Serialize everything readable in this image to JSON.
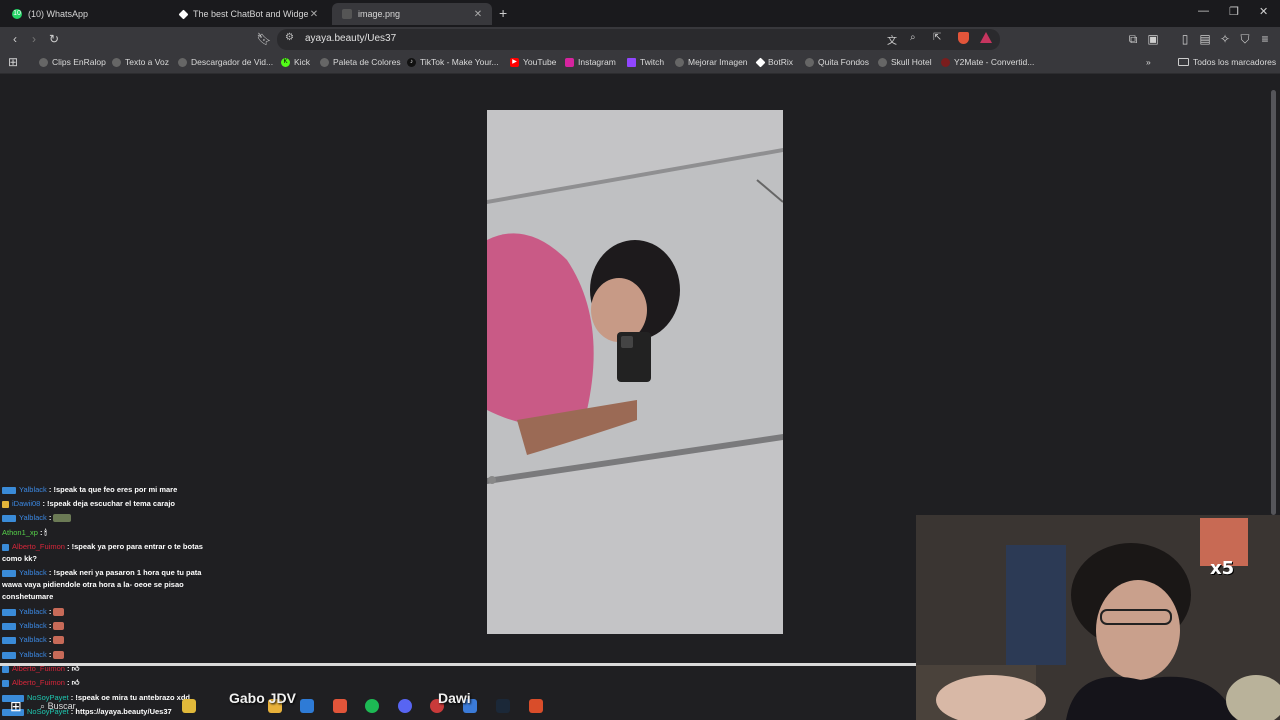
{
  "tabs": [
    {
      "title": "(10) WhatsApp"
    },
    {
      "title": "The best ChatBot and Widget"
    },
    {
      "title": "image.png"
    }
  ],
  "address": {
    "url": "ayaya.beauty/Ues37"
  },
  "bookmarks": {
    "items": [
      "Clips EnRalop",
      "Texto a Voz",
      "Descargador de Vid...",
      "Kick",
      "Paleta de Colores",
      "TikTok - Make Your...",
      "YouTube",
      "Instagram",
      "Twitch",
      "Mejorar Imagen",
      "BotRix",
      "Quita Fondos",
      "Skull Hotel",
      "Y2Mate - Convertid..."
    ],
    "all_label": "Todos los marcadores"
  },
  "chat": [
    {
      "user": "Yalblack",
      "user_color": "#3b87e0",
      "text": "!speak ta que feo eres por mi mare"
    },
    {
      "user": "iDawii08",
      "user_color": "#3b87e0",
      "text": "!speak deja escuchar el tema carajo"
    },
    {
      "user": "Yalblack",
      "user_color": "#3b87e0",
      "text": ""
    },
    {
      "user": "Athon1_xp",
      "user_color": "#56d24a",
      "text": ""
    },
    {
      "user": "Alberto_Fuimon",
      "user_color": "#d8263a",
      "text": "!speak ya pero para entrar o te botas"
    },
    {
      "user": "",
      "user_color": "#ffffff",
      "text": "como kk?"
    },
    {
      "user": "Yalblack",
      "user_color": "#3b87e0",
      "text": "!speak neri ya pasaron 1 hora que tu pata"
    },
    {
      "user": "",
      "user_color": "#ffffff",
      "text": "wawa vaya pidiendole otra hora a la- oeoe se pisao"
    },
    {
      "user": "",
      "user_color": "#ffffff",
      "text": "conshetumare"
    },
    {
      "user": "Yalblack",
      "user_color": "#3b87e0",
      "text": ""
    },
    {
      "user": "Yalblack",
      "user_color": "#3b87e0",
      "text": ""
    },
    {
      "user": "Yalblack",
      "user_color": "#3b87e0",
      "text": ""
    },
    {
      "user": "Yalblack",
      "user_color": "#3b87e0",
      "text": ""
    },
    {
      "user": "Alberto_Fuimon",
      "user_color": "#d8263a",
      "text": ""
    },
    {
      "user": "Alberto_Fuimon",
      "user_color": "#d8263a",
      "text": ""
    },
    {
      "user": "NoSoyPayet",
      "user_color": "#1fc7b0",
      "text": "!speak oe mira tu antebrazo xdd"
    },
    {
      "user": "NoSoyPayet",
      "user_color": "#1fc7b0",
      "text": "https://ayaya.beauty/Ues37"
    }
  ],
  "taskbar": {
    "search": "Buscar"
  },
  "overlay": {
    "name1": "Gabo JDV",
    "name2": "Dawi",
    "multiplier": "x5"
  }
}
